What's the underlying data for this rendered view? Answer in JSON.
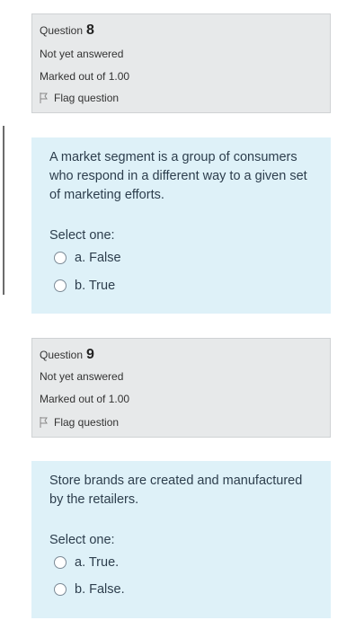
{
  "questions": [
    {
      "label": "Question",
      "number": "8",
      "status": "Not yet answered",
      "marks": "Marked out of 1.00",
      "flag_label": "Flag question",
      "text": "A market segment is a group of consumers who respond in a different way to a given set of marketing efforts.",
      "select_label": "Select one:",
      "options": [
        "a. False",
        "b. True"
      ]
    },
    {
      "label": "Question",
      "number": "9",
      "status": "Not yet answered",
      "marks": "Marked out of 1.00",
      "flag_label": "Flag question",
      "text": "Store brands are created and manufactured by the retailers.",
      "select_label": "Select one:",
      "options": [
        "a. True.",
        "b. False."
      ]
    }
  ],
  "colors": {
    "info_bg": "#e7e9ea",
    "content_bg": "#def1f8",
    "text": "#2d3e4d"
  }
}
